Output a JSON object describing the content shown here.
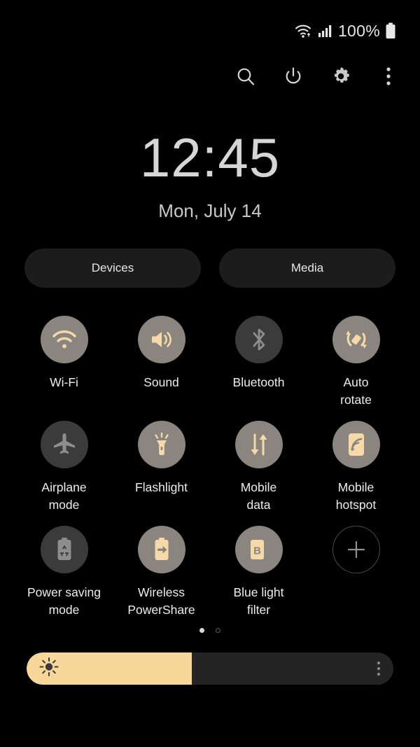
{
  "statusbar": {
    "wifi_icon": "wifi-data-icon",
    "signal_icon": "cellular-signal-icon",
    "battery_text": "100%",
    "battery_icon": "battery-full-icon"
  },
  "header": {
    "icons": [
      {
        "name": "search-icon",
        "label": "Search"
      },
      {
        "name": "power-icon",
        "label": "Power off"
      },
      {
        "name": "gear-icon",
        "label": "Settings"
      },
      {
        "name": "overflow-menu-icon",
        "label": "More options"
      }
    ]
  },
  "clock": {
    "time": "12:45",
    "date": "Mon, July 14"
  },
  "pills": [
    {
      "label": "Devices",
      "name": "devices-button"
    },
    {
      "label": "Media",
      "name": "media-button"
    }
  ],
  "tiles": [
    {
      "label": "Wi-Fi",
      "icon": "wifi-icon",
      "state": "on"
    },
    {
      "label": "Sound",
      "icon": "sound-icon",
      "state": "on"
    },
    {
      "label": "Bluetooth",
      "icon": "bluetooth-icon",
      "state": "off"
    },
    {
      "label": "Auto\nrotate",
      "icon": "auto-rotate-icon",
      "state": "on"
    },
    {
      "label": "Airplane\nmode",
      "icon": "airplane-icon",
      "state": "off"
    },
    {
      "label": "Flashlight",
      "icon": "flashlight-icon",
      "state": "on"
    },
    {
      "label": "Mobile\ndata",
      "icon": "mobile-data-icon",
      "state": "on"
    },
    {
      "label": "Mobile\nhotspot",
      "icon": "mobile-hotspot-icon",
      "state": "on"
    },
    {
      "label": "Power saving\nmode",
      "icon": "power-saving-icon",
      "state": "off"
    },
    {
      "label": "Wireless\nPowerShare",
      "icon": "wireless-powershare-icon",
      "state": "on"
    },
    {
      "label": "Blue light\nfilter",
      "icon": "blue-light-filter-icon",
      "state": "on"
    },
    {
      "label": "",
      "icon": "add-tile-icon",
      "state": "add"
    }
  ],
  "pagination": {
    "pages": 2,
    "active": 0
  },
  "brightness": {
    "value_percent": 45,
    "sun_icon": "brightness-sun-icon",
    "menu_icon": "brightness-options-icon"
  },
  "colors": {
    "background": "#000000",
    "tile_on": "#8a857e",
    "tile_off": "#3b3b3b",
    "accent": "#f8d79b",
    "icon_off": "#8d8d8d",
    "label": "#ededed",
    "pill_bg": "#1c1c1c"
  }
}
